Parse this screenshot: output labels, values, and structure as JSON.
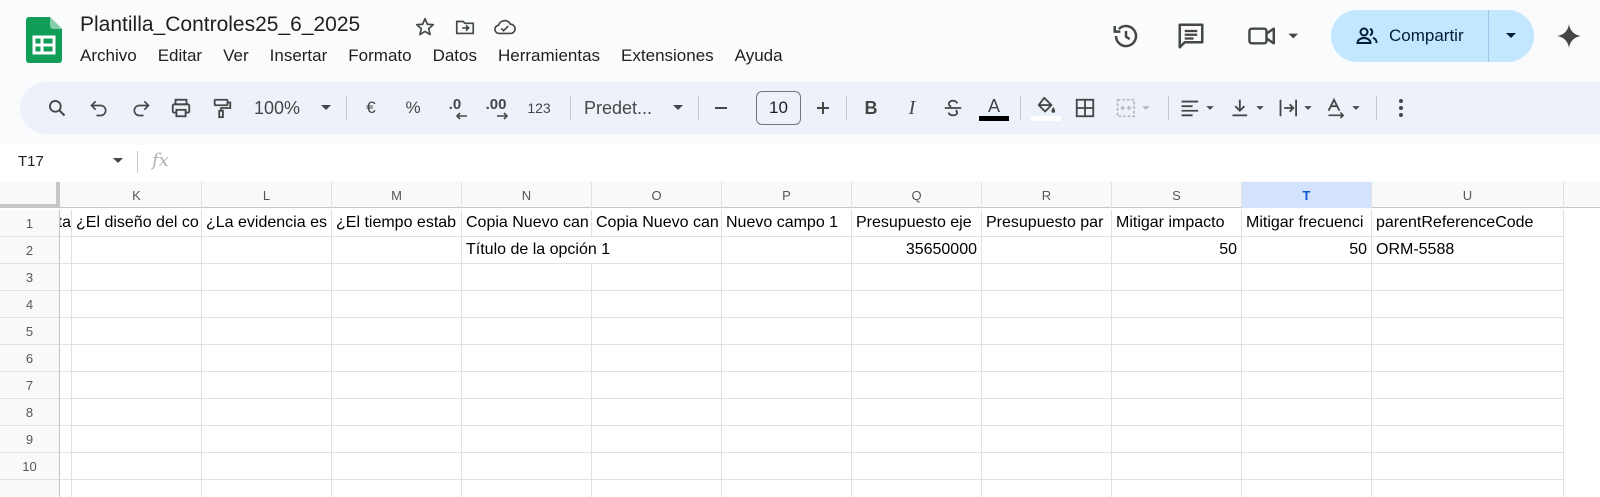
{
  "doc": {
    "title": "Plantilla_Controles25_6_2025",
    "brand_color": "#0f9d58"
  },
  "menu": [
    "Archivo",
    "Editar",
    "Ver",
    "Insertar",
    "Formato",
    "Datos",
    "Herramientas",
    "Extensiones",
    "Ayuda"
  ],
  "share": {
    "label": "Compartir",
    "color": "#c2e7ff"
  },
  "toolbar": {
    "zoom": "100%",
    "currency": "€",
    "percent": "%",
    "dec_decrease": ".0",
    "dec_increase": ".00",
    "number_format": "123",
    "font": "Predet...",
    "font_size": "10",
    "bold": "B",
    "italic": "I",
    "text_color_glyph": "A",
    "text_color_bar": "#000000"
  },
  "formula_bar": {
    "cell_ref": "T17",
    "fx": "fx"
  },
  "sheet": {
    "columns": [
      "K",
      "L",
      "M",
      "N",
      "O",
      "P",
      "Q",
      "R",
      "S",
      "T",
      "U"
    ],
    "selected_column": "T",
    "rows": [
      "1",
      "2",
      "3",
      "4",
      "5",
      "6",
      "7",
      "8",
      "9",
      "10"
    ],
    "partial_cell_j1": "ta",
    "header_row": [
      "¿El diseño del co",
      "¿La evidencia es",
      "¿El tiempo estab",
      "Copia Nuevo can",
      "Copia Nuevo can",
      "Nuevo campo 1",
      "Presupuesto eje",
      "Presupuesto par",
      "Mitigar impacto",
      "Mitigar frecuenci",
      "parentReferenceCode"
    ],
    "row2": {
      "N": "Título de la opción 1",
      "Q": "35650000",
      "S": "50",
      "T": "50",
      "U": "ORM-5588"
    }
  }
}
